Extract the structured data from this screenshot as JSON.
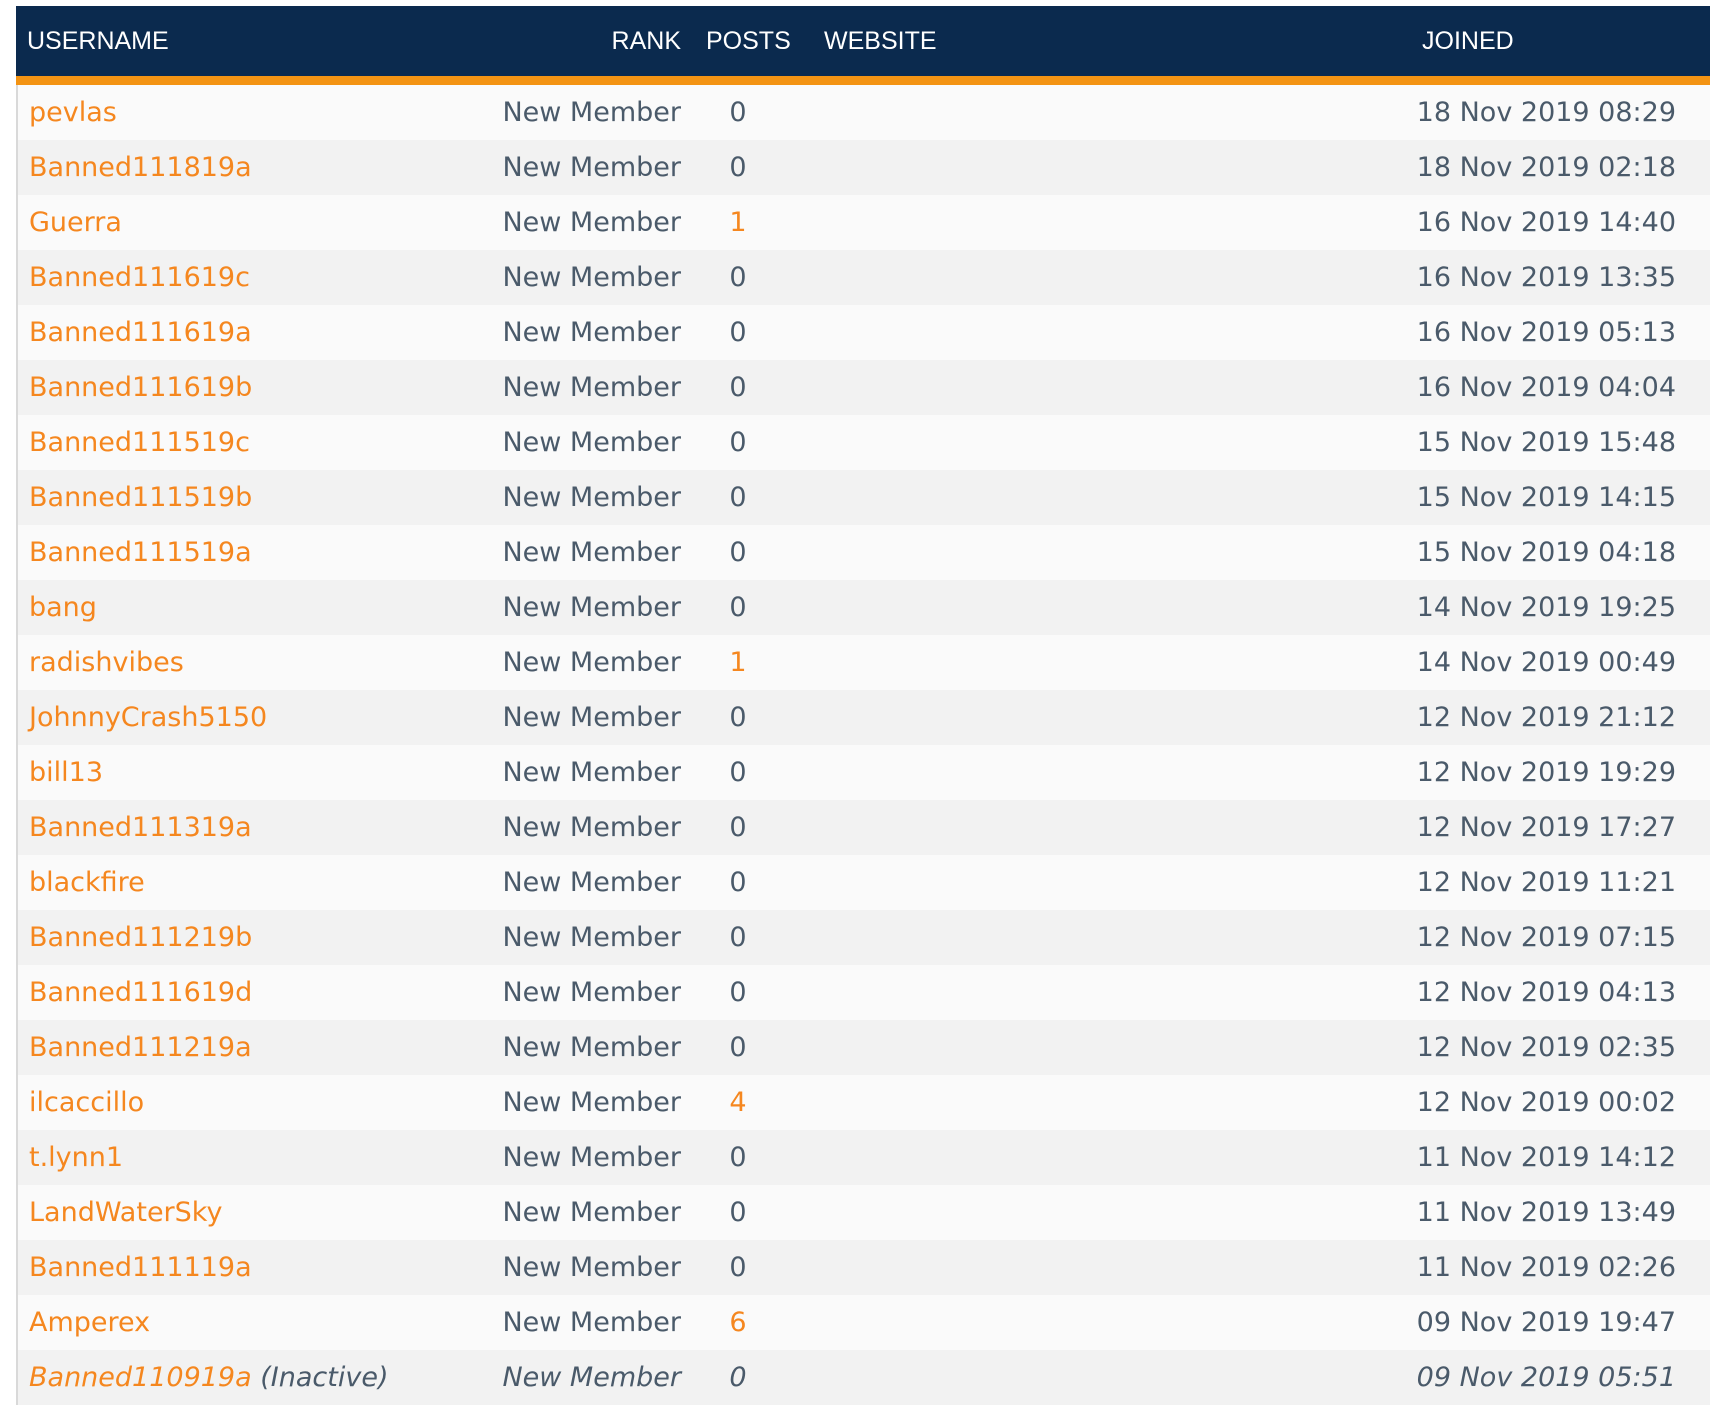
{
  "headers": {
    "username": "USERNAME",
    "rank": "RANK",
    "posts": "POSTS",
    "website": "WEBSITE",
    "joined": "JOINED"
  },
  "colors": {
    "header_bg": "#0b2a4e",
    "header_accent": "#f39313",
    "link": "#f5871f",
    "text": "#4a5a6a"
  },
  "members": [
    {
      "username": "pevlas",
      "rank": "New Member",
      "posts": "0",
      "website": "",
      "joined": "18 Nov 2019 08:29"
    },
    {
      "username": "Banned111819a",
      "rank": "New Member",
      "posts": "0",
      "website": "",
      "joined": "18 Nov 2019 02:18"
    },
    {
      "username": "Guerra",
      "rank": "New Member",
      "posts": "1",
      "website": "",
      "joined": "16 Nov 2019 14:40"
    },
    {
      "username": "Banned111619c",
      "rank": "New Member",
      "posts": "0",
      "website": "",
      "joined": "16 Nov 2019 13:35"
    },
    {
      "username": "Banned111619a",
      "rank": "New Member",
      "posts": "0",
      "website": "",
      "joined": "16 Nov 2019 05:13"
    },
    {
      "username": "Banned111619b",
      "rank": "New Member",
      "posts": "0",
      "website": "",
      "joined": "16 Nov 2019 04:04"
    },
    {
      "username": "Banned111519c",
      "rank": "New Member",
      "posts": "0",
      "website": "",
      "joined": "15 Nov 2019 15:48"
    },
    {
      "username": "Banned111519b",
      "rank": "New Member",
      "posts": "0",
      "website": "",
      "joined": "15 Nov 2019 14:15"
    },
    {
      "username": "Banned111519a",
      "rank": "New Member",
      "posts": "0",
      "website": "",
      "joined": "15 Nov 2019 04:18"
    },
    {
      "username": "bang",
      "rank": "New Member",
      "posts": "0",
      "website": "",
      "joined": "14 Nov 2019 19:25"
    },
    {
      "username": "radishvibes",
      "rank": "New Member",
      "posts": "1",
      "website": "",
      "joined": "14 Nov 2019 00:49"
    },
    {
      "username": "JohnnyCrash5150",
      "rank": "New Member",
      "posts": "0",
      "website": "",
      "joined": "12 Nov 2019 21:12"
    },
    {
      "username": "bill13",
      "rank": "New Member",
      "posts": "0",
      "website": "",
      "joined": "12 Nov 2019 19:29"
    },
    {
      "username": "Banned111319a",
      "rank": "New Member",
      "posts": "0",
      "website": "",
      "joined": "12 Nov 2019 17:27"
    },
    {
      "username": "blackfire",
      "rank": "New Member",
      "posts": "0",
      "website": "",
      "joined": "12 Nov 2019 11:21"
    },
    {
      "username": "Banned111219b",
      "rank": "New Member",
      "posts": "0",
      "website": "",
      "joined": "12 Nov 2019 07:15"
    },
    {
      "username": "Banned111619d",
      "rank": "New Member",
      "posts": "0",
      "website": "",
      "joined": "12 Nov 2019 04:13"
    },
    {
      "username": "Banned111219a",
      "rank": "New Member",
      "posts": "0",
      "website": "",
      "joined": "12 Nov 2019 02:35"
    },
    {
      "username": "ilcaccillo",
      "rank": "New Member",
      "posts": "4",
      "website": "",
      "joined": "12 Nov 2019 00:02"
    },
    {
      "username": "t.lynn1",
      "rank": "New Member",
      "posts": "0",
      "website": "",
      "joined": "11 Nov 2019 14:12"
    },
    {
      "username": "LandWaterSky",
      "rank": "New Member",
      "posts": "0",
      "website": "",
      "joined": "11 Nov 2019 13:49"
    },
    {
      "username": "Banned111119a",
      "rank": "New Member",
      "posts": "0",
      "website": "",
      "joined": "11 Nov 2019 02:26"
    },
    {
      "username": "Amperex",
      "rank": "New Member",
      "posts": "6",
      "website": "",
      "joined": "09 Nov 2019 19:47"
    },
    {
      "username": "Banned110919a",
      "status": "(Inactive)",
      "rank": "New Member",
      "posts": "0",
      "website": "",
      "joined": "09 Nov 2019 05:51"
    }
  ]
}
